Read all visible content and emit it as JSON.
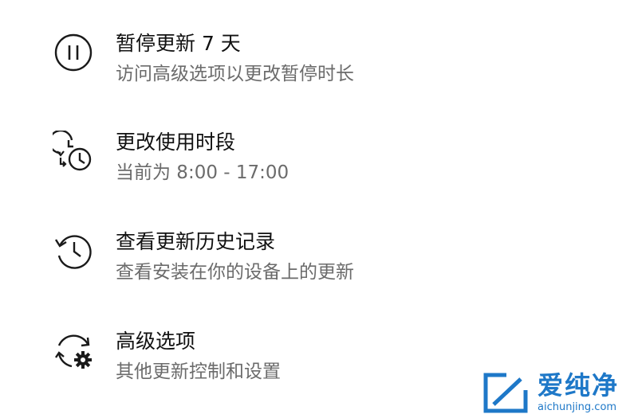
{
  "options": [
    {
      "icon": "pause-icon",
      "title": "暂停更新 7 天",
      "subtitle": "访问高级选项以更改暂停时长"
    },
    {
      "icon": "active-hours-clock-icon",
      "title": "更改使用时段",
      "subtitle": "当前为 8:00 - 17:00"
    },
    {
      "icon": "history-icon",
      "title": "查看更新历史记录",
      "subtitle": "查看安装在你的设备上的更新"
    },
    {
      "icon": "sync-gear-icon",
      "title": "高级选项",
      "subtitle": "其他更新控制和设置"
    }
  ],
  "watermark": {
    "brand": "爱纯净",
    "site": "aichunjing.com",
    "color": "#1e78c8"
  },
  "colors": {
    "title": "#111111",
    "subtitle": "#6b6b6b",
    "icon": "#1a1a1a"
  }
}
